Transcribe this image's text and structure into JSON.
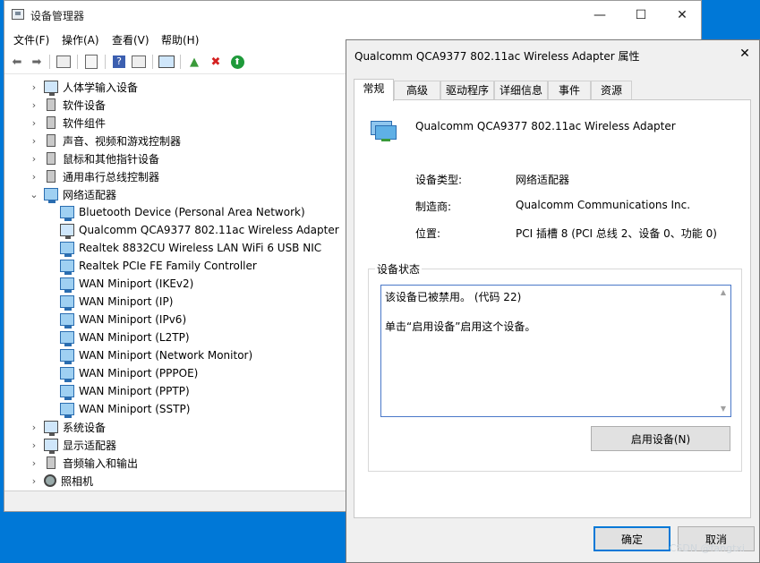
{
  "devmgr": {
    "title": "设备管理器",
    "menu": [
      "文件(F)",
      "操作(A)",
      "查看(V)",
      "帮助(H)"
    ],
    "win_controls": {
      "minimize": "—",
      "maximize": "☐",
      "close": "✕"
    },
    "tree": [
      {
        "label": "人体学输入设备"
      },
      {
        "label": "软件设备"
      },
      {
        "label": "软件组件"
      },
      {
        "label": "声音、视频和游戏控制器"
      },
      {
        "label": "鼠标和其他指针设备"
      },
      {
        "label": "通用串行总线控制器"
      },
      {
        "label": "网络适配器"
      },
      {
        "label": "Bluetooth Device (Personal Area Network)"
      },
      {
        "label": "Qualcomm QCA9377 802.11ac Wireless Adapter"
      },
      {
        "label": "Realtek 8832CU Wireless LAN WiFi 6 USB NIC"
      },
      {
        "label": "Realtek PCIe FE Family Controller"
      },
      {
        "label": "WAN Miniport (IKEv2)"
      },
      {
        "label": "WAN Miniport (IP)"
      },
      {
        "label": "WAN Miniport (IPv6)"
      },
      {
        "label": "WAN Miniport (L2TP)"
      },
      {
        "label": "WAN Miniport (Network Monitor)"
      },
      {
        "label": "WAN Miniport (PPPOE)"
      },
      {
        "label": "WAN Miniport (PPTP)"
      },
      {
        "label": "WAN Miniport (SSTP)"
      },
      {
        "label": "系统设备"
      },
      {
        "label": "显示适配器"
      },
      {
        "label": "音频输入和输出"
      },
      {
        "label": "照相机"
      }
    ]
  },
  "dialog": {
    "title": "Qualcomm QCA9377 802.11ac Wireless Adapter 属性",
    "close": "✕",
    "tabs": [
      "常规",
      "高级",
      "驱动程序",
      "详细信息",
      "事件",
      "资源"
    ],
    "device_name": "Qualcomm QCA9377 802.11ac Wireless Adapter",
    "device_type_label": "设备类型:",
    "device_type": "网络适配器",
    "manufacturer_label": "制造商:",
    "manufacturer": "Qualcomm Communications Inc.",
    "location_label": "位置:",
    "location": "PCI 插槽 8 (PCI 总线 2、设备 0、功能 0)",
    "status_group_label": "设备状态",
    "status_line1": "该设备已被禁用。 (代码 22)",
    "status_line2": "单击“启用设备”启用这个设备。",
    "enable_button": "启用设备(N)",
    "ok_button": "确定",
    "cancel_button": "取消"
  },
  "watermark": "CSDN @fangtxi"
}
